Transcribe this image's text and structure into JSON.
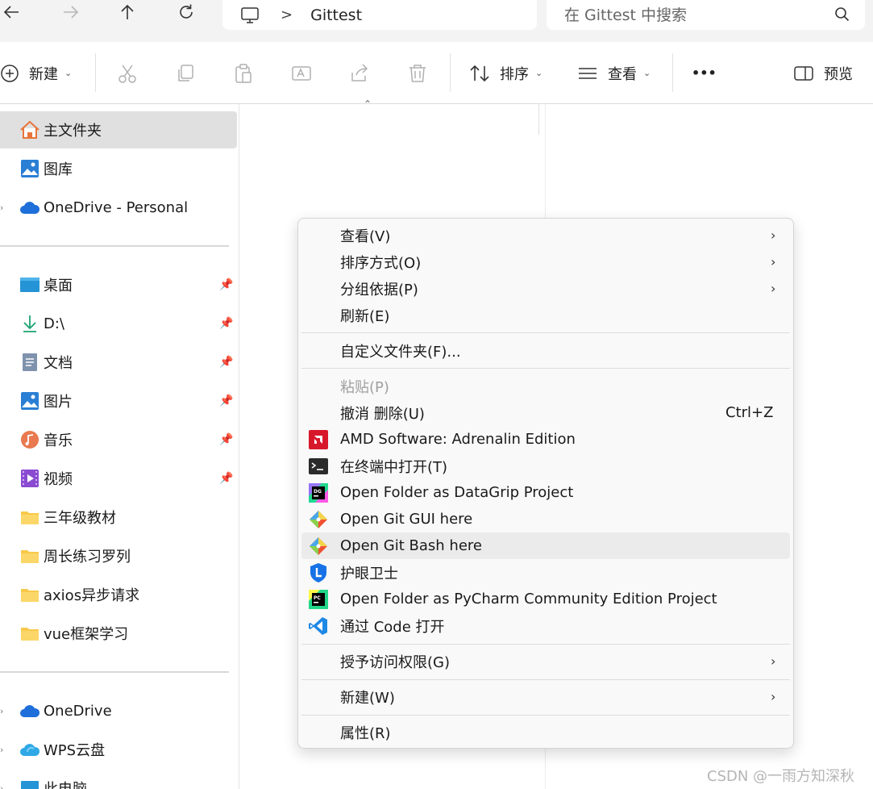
{
  "address_bar": {
    "back_icon": "arrow-left-icon",
    "forward_icon": "arrow-right-icon",
    "up_icon": "arrow-up-icon",
    "refresh_icon": "refresh-icon",
    "path_root_icon": "this-pc-icon",
    "path_separator": ">",
    "path_current": "Gittest",
    "search_placeholder": "在 Gittest 中搜索"
  },
  "toolbar": {
    "new_label": "新建",
    "sort_label": "排序",
    "view_label": "查看",
    "more_label": "•••",
    "preview_label": "预览"
  },
  "sidebar": {
    "home": "主文件夹",
    "gallery": "图库",
    "onedrive_personal": "OneDrive - Personal",
    "pinned": [
      {
        "label": "桌面",
        "icon": "desktop-icon"
      },
      {
        "label": "D:\\",
        "icon": "download-icon"
      },
      {
        "label": "文档",
        "icon": "documents-icon"
      },
      {
        "label": "图片",
        "icon": "pictures-icon"
      },
      {
        "label": "音乐",
        "icon": "music-icon"
      },
      {
        "label": "视频",
        "icon": "videos-icon"
      }
    ],
    "folders": [
      {
        "label": "三年级教材"
      },
      {
        "label": "周长练习罗列"
      },
      {
        "label": "axios异步请求"
      },
      {
        "label": "vue框架学习"
      }
    ],
    "onedrive": "OneDrive",
    "wps": "WPS云盘",
    "this_pc": "此电脑"
  },
  "context_menu": {
    "view": "查看(V)",
    "sort_by": "排序方式(O)",
    "group_by": "分组依据(P)",
    "refresh": "刷新(E)",
    "customize": "自定义文件夹(F)...",
    "paste": "粘贴(P)",
    "undo_delete": "撤消 删除(U)",
    "undo_shortcut": "Ctrl+Z",
    "amd": "AMD Software: Adrenalin Edition",
    "terminal": "在终端中打开(T)",
    "datagrip": "Open Folder as DataGrip Project",
    "git_gui": "Open Git GUI here",
    "git_bash": "Open Git Bash here",
    "eye_guard": "护眼卫士",
    "pycharm": "Open Folder as PyCharm Community Edition Project",
    "vscode": "通过 Code 打开",
    "grant_access": "授予访问权限(G)",
    "new": "新建(W)",
    "properties": "属性(R)"
  },
  "watermark": "CSDN @一雨方知深秋",
  "colors": {
    "folder_yellow": "#f8c94a",
    "amd_red": "#d7182a",
    "git_orange": "#f05133",
    "vscode_blue": "#1e88e5",
    "onedrive_blue": "#1e6fd9"
  }
}
